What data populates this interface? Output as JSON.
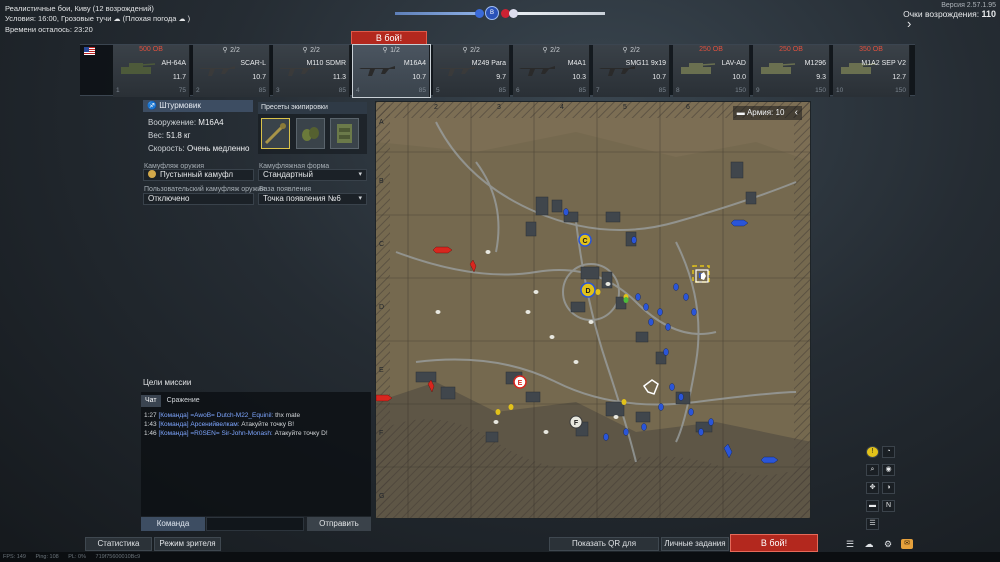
{
  "top_info": {
    "line1": "Реалистичные бои, Киву (12 возрождений)",
    "line2_prefix": "Условия: 16:00, Грозовые тучи",
    "line2_weather": "(Плохая погода",
    "line2_suffix": ")",
    "line3": "Времени осталось: 23:20"
  },
  "top_right": {
    "version": "Версия 2.57.1.95",
    "respawn_label": "Очки возрождения:",
    "respawn_value": "110"
  },
  "score": {
    "left_color": "#8fb2e8",
    "right_color": "#e6ebf0",
    "center_label": "B"
  },
  "top_battle_button": "В бой!",
  "slots": [
    {
      "cost": "500 ОВ",
      "count": "",
      "name": "AH-64A",
      "br": "11.7",
      "foot_l": "1",
      "foot_r": "75"
    },
    {
      "cost": "",
      "count": "2/2",
      "name": "SCAR-L",
      "br": "10.7",
      "foot_l": "2",
      "foot_r": "85"
    },
    {
      "cost": "",
      "count": "2/2",
      "name": "M110 SDMR",
      "br": "11.3",
      "foot_l": "3",
      "foot_r": "85"
    },
    {
      "cost": "",
      "count": "1/2",
      "name": "M16A4",
      "br": "10.7",
      "foot_l": "4",
      "foot_r": "85"
    },
    {
      "cost": "",
      "count": "2/2",
      "name": "M249 Para",
      "br": "9.7",
      "foot_l": "5",
      "foot_r": "85"
    },
    {
      "cost": "",
      "count": "2/2",
      "name": "M4A1",
      "br": "10.3",
      "foot_l": "6",
      "foot_r": "85"
    },
    {
      "cost": "",
      "count": "2/2",
      "name": "SMG11 9x19",
      "br": "10.7",
      "foot_l": "7",
      "foot_r": "85"
    },
    {
      "cost": "250 ОВ",
      "count": "",
      "name": "LAV-AD",
      "br": "10.0",
      "foot_l": "8",
      "foot_r": "150"
    },
    {
      "cost": "250 ОВ",
      "count": "",
      "name": "M1296",
      "br": "9.3",
      "foot_l": "9",
      "foot_r": "150"
    },
    {
      "cost": "350 ОВ",
      "count": "",
      "name": "M1A2 SEP V2",
      "br": "12.7",
      "foot_l": "10",
      "foot_r": "150"
    }
  ],
  "loadout": {
    "class_label": "Штурмовик",
    "weapon_label": "Вооружение:",
    "weapon_value": "M16A4",
    "weight_label": "Вес:",
    "weight_value": "51.8 кг",
    "speed_label": "Скорость:",
    "speed_value": "Очень медленно",
    "presets_label": "Пресеты экипировки"
  },
  "fields": {
    "weapon_camo_label": "Камуфляж оружия",
    "weapon_camo_value": "Пустынный камуфл",
    "uniform_label": "Камуфляжная форма",
    "uniform_value": "Стандартный",
    "custom_camo_label": "Пользовательский камуфляж оружия",
    "custom_camo_value": "Отключено",
    "spawn_base_label": "База появления",
    "spawn_base_value": "Точка появления №6"
  },
  "mission": {
    "title": "Цели миссии"
  },
  "chat": {
    "tab_chat": "Чат",
    "tab_battle": "Сражение",
    "messages": [
      {
        "time": "1:27",
        "sender": "[Команда] =AwoB= Dutch-M22_Equinil:",
        "text": "thx mate"
      },
      {
        "time": "1:43",
        "sender": "[Команда] Арсенийвелкам:",
        "text": "Атакуйте точку B!"
      },
      {
        "time": "1:46",
        "sender": "[Команда] =R0SEN= Sir-John-Monash:",
        "text": "Атакуйте точку D!"
      }
    ],
    "team_button": "Команда",
    "input_placeholder": "",
    "send_button": "Отправить"
  },
  "bottom": {
    "stats_button": "Статистика",
    "spectator_button": "Режим зрителя",
    "qr_button": "Показать QR для Ассистента",
    "tasks_button": "Личные задания",
    "battle_button": "В бой!",
    "fps": "FPS: 149",
    "ping": "Ping: 108",
    "pl": "PL: 0%",
    "build_id": "719f75600010Bc9"
  },
  "map": {
    "army_label": "Армия:",
    "army_value": "10",
    "columns": [
      "2",
      "3",
      "4",
      "5",
      "6"
    ],
    "rows": [
      "A",
      "B",
      "C",
      "D",
      "E",
      "F",
      "G"
    ],
    "points": [
      "B",
      "C",
      "E",
      "D",
      "F"
    ],
    "allied_color": "#2a55d8",
    "enemy_color": "#d8261e",
    "neutral_color": "#e8e8e8",
    "objective_color": "#e2c21a"
  },
  "toolbar": {
    "icons": [
      "warning-icon",
      "sector-icon",
      "zoom-icon",
      "compass-icon",
      "move-icon",
      "pie-icon",
      "tank-icon",
      "north-icon",
      "settings-icon"
    ],
    "north_label": "N"
  },
  "corner_icons": [
    "list-icon",
    "squad-icon",
    "settings-icon",
    "mail-icon"
  ]
}
